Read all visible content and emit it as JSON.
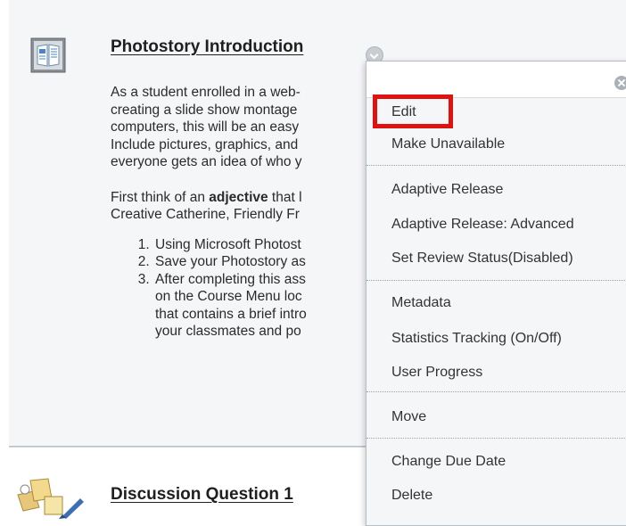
{
  "item1": {
    "title": "Photostory Introduction",
    "paragraph1": [
      "As a student enrolled in a web-",
      "creating a slide show montage",
      "computers, this will be an easy",
      "Include pictures, graphics, and",
      "everyone gets an idea of who y"
    ],
    "p2_line1_pre": "First think of an ",
    "p2_line1_bold": "adjective",
    "p2_line1_post": " that l",
    "p2_line2": "Creative Catherine, Friendly Fr",
    "steps": [
      "Using Microsoft Photost",
      "Save your Photostory as",
      "After completing this ass"
    ],
    "step3_continuation": [
      "on the Course Menu loc",
      "that contains a brief intro",
      "your classmates and po"
    ]
  },
  "item2": {
    "title": "Discussion Question 1"
  },
  "menu": {
    "items": [
      "Edit",
      "Make Unavailable",
      "Adaptive Release",
      "Adaptive Release: Advanced",
      "Set Review Status(Disabled)",
      "Metadata",
      "Statistics Tracking (On/Off)",
      "User Progress",
      "Move",
      "Change Due Date",
      "Delete"
    ]
  },
  "colors": {
    "highlight": "#e0120f",
    "panel": "#f5f6f8",
    "text": "#222222"
  },
  "icons": {
    "item1": "document-icon",
    "item2": "discussion-icon",
    "menu_toggle": "chevron-down-icon",
    "menu_close": "close-icon"
  }
}
